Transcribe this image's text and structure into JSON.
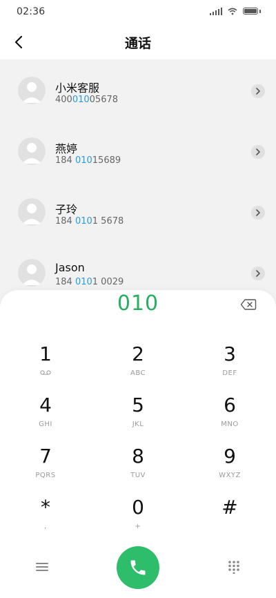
{
  "status_bar": {
    "time": "02:36"
  },
  "header": {
    "title": "通话"
  },
  "contacts": [
    {
      "name": "小米客服",
      "number_pre": "400",
      "number_match": "010",
      "number_post": "05678"
    },
    {
      "name": "燕婷",
      "number_pre": "184 ",
      "number_match": "010",
      "number_post": "15689"
    },
    {
      "name": "子玲",
      "number_pre": "184 ",
      "number_match": "010",
      "number_post": "1 5678"
    },
    {
      "name": "Jason",
      "number_pre": "184 ",
      "number_match": "010",
      "number_post": "1 0029"
    }
  ],
  "dialer": {
    "dialed_number": "010",
    "keys": [
      {
        "digit": "1",
        "letters": "",
        "sub_icon": "voicemail-icon"
      },
      {
        "digit": "2",
        "letters": "ABC"
      },
      {
        "digit": "3",
        "letters": "DEF"
      },
      {
        "digit": "4",
        "letters": "GHI"
      },
      {
        "digit": "5",
        "letters": "JKL"
      },
      {
        "digit": "6",
        "letters": "MNO"
      },
      {
        "digit": "7",
        "letters": "PQRS"
      },
      {
        "digit": "8",
        "letters": "TUV"
      },
      {
        "digit": "9",
        "letters": "WXYZ"
      },
      {
        "digit": "*",
        "letters": ","
      },
      {
        "digit": "0",
        "letters": "+"
      },
      {
        "digit": "#",
        "letters": ""
      }
    ]
  },
  "colors": {
    "accent_green": "#2ebd6b",
    "number_green": "#27ae60",
    "match_blue": "#2c9ad6",
    "list_background": "#f2f2f2"
  }
}
